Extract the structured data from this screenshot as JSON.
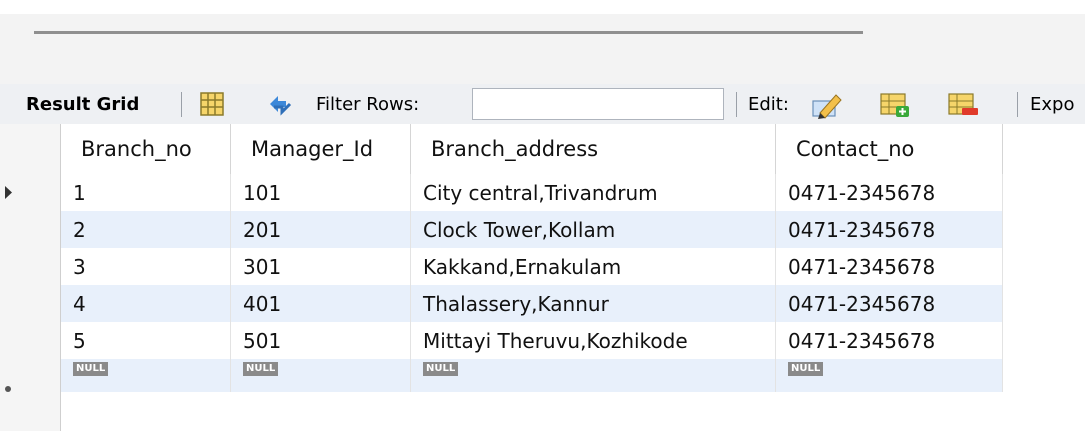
{
  "toolbar": {
    "result_grid_label": "Result Grid",
    "filter_rows_label": "Filter Rows:",
    "filter_value": "",
    "edit_label": "Edit:",
    "export_label_cut": "Expo"
  },
  "grid": {
    "columns": [
      "Branch_no",
      "Manager_Id",
      "Branch_address",
      "Contact_no"
    ],
    "rows": [
      [
        "1",
        "101",
        "City central,Trivandrum",
        "0471-2345678"
      ],
      [
        "2",
        "201",
        "Clock Tower,Kollam",
        "0471-2345678"
      ],
      [
        "3",
        "301",
        "Kakkand,Ernakulam",
        "0471-2345678"
      ],
      [
        "4",
        "401",
        "Thalassery,Kannur",
        "0471-2345678"
      ],
      [
        "5",
        "501",
        "Mittayi Theruvu,Kozhikode",
        "0471-2345678"
      ]
    ],
    "new_row": [
      "NULL",
      "NULL",
      "NULL",
      "NULL"
    ]
  },
  "icons": {
    "form-view": "form-view-icon",
    "refresh": "refresh-icon",
    "edit": "edit-pencil-icon",
    "insert-row": "insert-row-icon",
    "delete-row": "delete-row-icon",
    "current-row": "current-row-arrow-icon",
    "new-row": "new-row-asterisk-icon"
  },
  "colors": {
    "accent_blue": "#2f78d1",
    "row_alt": "#e8f0fb",
    "null_badge": "#8a8a8a"
  }
}
